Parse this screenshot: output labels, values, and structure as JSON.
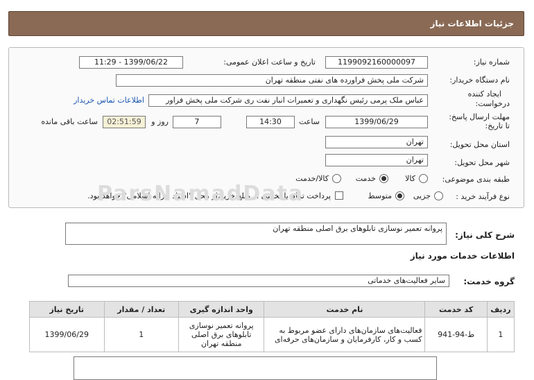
{
  "header": {
    "title": "جزئیات اطلاعات نیاز"
  },
  "form": {
    "need_number_label": "شماره نیاز:",
    "need_number": "1199092160000097",
    "announce_label": "تاریخ و ساعت اعلان عمومی:",
    "announce_value": "1399/06/22 - 11:29",
    "buyer_label": "نام دستگاه خریدار:",
    "buyer_value": "شرکت ملی پخش فراورده های نفتی منطقه تهران",
    "creator_label_1": "ایجاد کننده",
    "creator_label_2": "درخواست:",
    "creator_value": "عباس ملک پرمی رئیس نگهداری و تعمیرات انبار نفت ری شرکت ملی پخش فراور",
    "contact_link": "اطلاعات تماس خریدار",
    "deadline_label_1": "مهلت ارسال پاسخ:",
    "deadline_label_2": "تا تاریخ:",
    "deadline_date": "1399/06/29",
    "time_label": "ساعت",
    "deadline_time": "14:30",
    "days_value": "7",
    "days_label": "روز و",
    "timer_value": "02:51:59",
    "remaining_label": "ساعت باقی مانده",
    "province_label": "استان محل تحویل:",
    "province_value": "تهران",
    "city_label": "شهر محل تحویل:",
    "city_value": "تهران",
    "category_label": "طبقه بندی موضوعی:",
    "category_options": [
      "کالا",
      "خدمت",
      "کالا/خدمت"
    ],
    "process_label": "نوع فرآیند خرید :",
    "process_options": [
      "جزیی",
      "متوسط"
    ],
    "payment_text": "پرداخت تمام یا بخشی از مبلغ خرید،از محل \"اسناد خزانه اسلامی\" خواهد بود."
  },
  "description": {
    "label": "شرح کلی نیاز:",
    "value": "پروانه تعمیر نوسازی تابلوهای برق اصلی منطقه تهران"
  },
  "services_title": "اطلاعات خدمات مورد نیاز",
  "service_group": {
    "label": "گروه خدمت:",
    "value": "سایر فعالیت‌های خدماتی"
  },
  "table": {
    "headers": [
      "ردیف",
      "کد خدمت",
      "نام خدمت",
      "واحد اندازه گیری",
      "تعداد / مقدار",
      "تاریخ نیاز"
    ],
    "row": {
      "index": "1",
      "code": "ط-94-941",
      "name": "فعالیت‌های سازمان‌های دارای عضو مربوط به کسب و کار، کارفرمایان و سازمان‌های حرفه‌ای",
      "unit": "پروانه تعمیر نوسازی تابلوهای برق اصلی منطقه تهران",
      "qty": "1",
      "date": "1399/06/29"
    }
  },
  "watermark": "ParsNamadData"
}
